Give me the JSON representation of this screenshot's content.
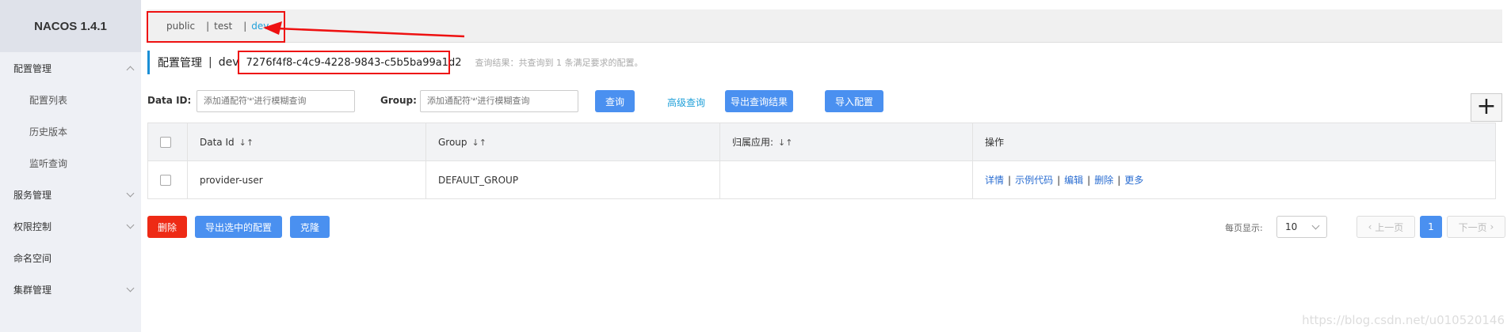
{
  "app": {
    "logo": "NACOS 1.4.1"
  },
  "sidebar": {
    "items": [
      {
        "label": "配置管理",
        "expanded": true
      },
      {
        "label": "配置列表",
        "sub": true
      },
      {
        "label": "历史版本",
        "sub": true
      },
      {
        "label": "监听查询",
        "sub": true
      },
      {
        "label": "服务管理",
        "expanded": false
      },
      {
        "label": "权限控制",
        "expanded": false
      },
      {
        "label": "命名空间"
      },
      {
        "label": "集群管理",
        "expanded": false
      }
    ]
  },
  "namespaces": {
    "items": [
      "public",
      "test",
      "dev"
    ],
    "separator": "|",
    "active": "dev"
  },
  "title": {
    "main": "配置管理",
    "sep": "|",
    "namespace": "dev",
    "namespace_id": "7276f4f8-c4c9-4228-9843-c5b5ba99a1d2",
    "hint": "查询结果：共查询到 1 条满足要求的配置。"
  },
  "search": {
    "data_id_label": "Data ID:",
    "data_id_placeholder": "添加通配符'*'进行模糊查询",
    "group_label": "Group:",
    "group_placeholder": "添加通配符'*'进行模糊查询",
    "query_btn": "查询",
    "advanced": "高级查询",
    "export_btn": "导出查询结果",
    "import_btn": "导入配置",
    "plus": "+"
  },
  "table": {
    "columns": [
      "Data Id",
      "Group",
      "归属应用:",
      "操作"
    ],
    "sort_icon": "↓↑",
    "rows": [
      {
        "data_id": "provider-user",
        "group": "DEFAULT_GROUP",
        "app": "",
        "ops": [
          "详情",
          "示例代码",
          "编辑",
          "删除",
          "更多"
        ]
      }
    ],
    "op_sep": "|"
  },
  "bottom": {
    "delete_btn": "删除",
    "export_selected_btn": "导出选中的配置",
    "clone_btn": "克隆",
    "page_size_label": "每页显示:",
    "page_size": "10",
    "prev": "上一页",
    "page": "1",
    "next": "下一页"
  },
  "watermark": "https://blog.csdn.net/u010520146",
  "colors": {
    "accent": "#4a90f0",
    "danger": "#ee2a15",
    "link": "#2a6dd1",
    "annotation": "#e11111"
  }
}
